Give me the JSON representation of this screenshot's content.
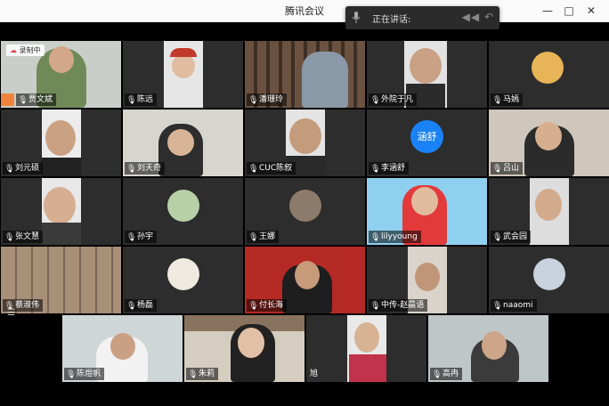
{
  "window": {
    "title": "腾讯会议",
    "minimize_icon": "minimize-icon",
    "maximize_icon": "maximize-icon",
    "close_icon": "close-icon"
  },
  "speaking": {
    "label": "正在讲话:"
  },
  "recording": {
    "label": "录制中"
  },
  "avatar_text": "涵舒",
  "participants": [
    "贾文斌",
    "陈远",
    "潘珊玲",
    "外院于凡",
    "马嫣",
    "刘元硕",
    "刘天奇",
    "CUC陈叙",
    "李涵舒",
    "吕山",
    "张文慧",
    "孙宇",
    "王娜",
    "lilyyoung",
    "武会园",
    "蔡淑伟",
    "杨磊",
    "付长海",
    "中传-赵晨语",
    "naaomi",
    "陈煜帆",
    "朱莉",
    "旭",
    "高冉"
  ],
  "colors": {
    "accent": "#1a82f7",
    "tile_bg": "#2d2d2d",
    "record": "#d8444a"
  }
}
